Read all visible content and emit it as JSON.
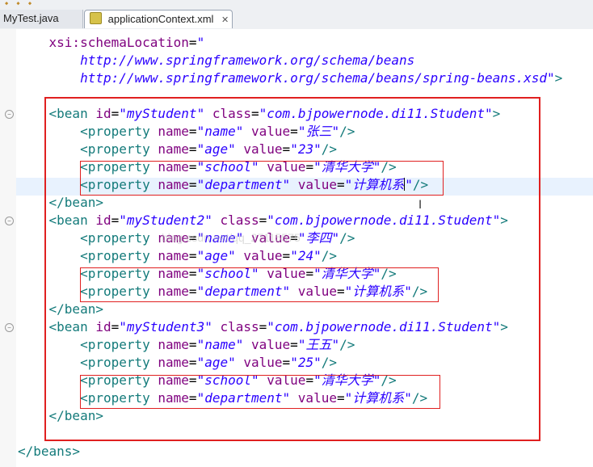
{
  "tabs": [
    {
      "label": "MyTest.java",
      "active": false
    },
    {
      "label": "applicationContext.xml",
      "active": true
    }
  ],
  "editor": {
    "cursor_line": 8,
    "lines": [
      {
        "tokens": [
          [
            "plain",
            "    "
          ],
          [
            "attr",
            "xsi:schemaLocation"
          ],
          [
            "plain",
            "="
          ],
          [
            "val",
            "\""
          ]
        ]
      },
      {
        "tokens": [
          [
            "plain",
            "        "
          ],
          [
            "val",
            "http://www.springframework.org/schema/beans"
          ]
        ]
      },
      {
        "tokens": [
          [
            "plain",
            "        "
          ],
          [
            "val",
            "http://www.springframework.org/schema/beans/spring-beans.xsd\""
          ],
          [
            "tag",
            ">"
          ]
        ]
      },
      {
        "tokens": []
      },
      {
        "tokens": [
          [
            "plain",
            "    "
          ],
          [
            "tag",
            "<bean "
          ],
          [
            "attr",
            "id"
          ],
          [
            "plain",
            "="
          ],
          [
            "val",
            "\"myStudent\""
          ],
          [
            "plain",
            " "
          ],
          [
            "attr",
            "class"
          ],
          [
            "plain",
            "="
          ],
          [
            "val",
            "\"com.bjpowernode.di11.Student\""
          ],
          [
            "tag",
            ">"
          ]
        ]
      },
      {
        "tokens": [
          [
            "plain",
            "        "
          ],
          [
            "tag",
            "<property "
          ],
          [
            "attr",
            "name"
          ],
          [
            "plain",
            "="
          ],
          [
            "val",
            "\"name\""
          ],
          [
            "plain",
            " "
          ],
          [
            "attr",
            "value"
          ],
          [
            "plain",
            "="
          ],
          [
            "val",
            "\"张三\""
          ],
          [
            "tag",
            "/>"
          ]
        ]
      },
      {
        "tokens": [
          [
            "plain",
            "        "
          ],
          [
            "tag",
            "<property "
          ],
          [
            "attr",
            "name"
          ],
          [
            "plain",
            "="
          ],
          [
            "val",
            "\"age\""
          ],
          [
            "plain",
            " "
          ],
          [
            "attr",
            "value"
          ],
          [
            "plain",
            "="
          ],
          [
            "val",
            "\"23\""
          ],
          [
            "tag",
            "/>"
          ]
        ]
      },
      {
        "tokens": [
          [
            "plain",
            "        "
          ],
          [
            "tag",
            "<property "
          ],
          [
            "attr",
            "name"
          ],
          [
            "plain",
            "="
          ],
          [
            "val",
            "\"school\""
          ],
          [
            "plain",
            " "
          ],
          [
            "attr",
            "value"
          ],
          [
            "plain",
            "="
          ],
          [
            "val",
            "\"清华大学\""
          ],
          [
            "tag",
            "/>"
          ]
        ]
      },
      {
        "tokens": [
          [
            "plain",
            "        "
          ],
          [
            "tag",
            "<property "
          ],
          [
            "attr",
            "name"
          ],
          [
            "plain",
            "="
          ],
          [
            "val",
            "\"department\""
          ],
          [
            "plain",
            " "
          ],
          [
            "attr",
            "value"
          ],
          [
            "plain",
            "="
          ],
          [
            "val",
            "\"计算机系"
          ],
          [
            "cursor",
            ""
          ],
          [
            "val",
            "\""
          ],
          [
            "tag",
            "/>"
          ]
        ]
      },
      {
        "tokens": [
          [
            "plain",
            "    "
          ],
          [
            "tag",
            "</bean>"
          ]
        ]
      },
      {
        "tokens": [
          [
            "plain",
            "    "
          ],
          [
            "tag",
            "<bean "
          ],
          [
            "attr",
            "id"
          ],
          [
            "plain",
            "="
          ],
          [
            "val",
            "\"myStudent2\""
          ],
          [
            "plain",
            " "
          ],
          [
            "attr",
            "class"
          ],
          [
            "plain",
            "="
          ],
          [
            "val",
            "\"com.bjpowernode.di11.Student\""
          ],
          [
            "tag",
            ">"
          ]
        ]
      },
      {
        "tokens": [
          [
            "plain",
            "        "
          ],
          [
            "tag",
            "<property "
          ],
          [
            "attr",
            "name"
          ],
          [
            "plain",
            "="
          ],
          [
            "val",
            "\"name\""
          ],
          [
            "plain",
            " "
          ],
          [
            "attr",
            "value"
          ],
          [
            "plain",
            "="
          ],
          [
            "val",
            "\"李四\""
          ],
          [
            "tag",
            "/>"
          ]
        ]
      },
      {
        "tokens": [
          [
            "plain",
            "        "
          ],
          [
            "tag",
            "<property "
          ],
          [
            "attr",
            "name"
          ],
          [
            "plain",
            "="
          ],
          [
            "val",
            "\"age\""
          ],
          [
            "plain",
            " "
          ],
          [
            "attr",
            "value"
          ],
          [
            "plain",
            "="
          ],
          [
            "val",
            "\"24\""
          ],
          [
            "tag",
            "/>"
          ]
        ]
      },
      {
        "tokens": [
          [
            "plain",
            "        "
          ],
          [
            "tag",
            "<property "
          ],
          [
            "attr",
            "name"
          ],
          [
            "plain",
            "="
          ],
          [
            "val",
            "\"school\""
          ],
          [
            "plain",
            " "
          ],
          [
            "attr",
            "value"
          ],
          [
            "plain",
            "="
          ],
          [
            "val",
            "\"清华大学\""
          ],
          [
            "tag",
            "/>"
          ]
        ]
      },
      {
        "tokens": [
          [
            "plain",
            "        "
          ],
          [
            "tag",
            "<property "
          ],
          [
            "attr",
            "name"
          ],
          [
            "plain",
            "="
          ],
          [
            "val",
            "\"department\""
          ],
          [
            "plain",
            " "
          ],
          [
            "attr",
            "value"
          ],
          [
            "plain",
            "="
          ],
          [
            "val",
            "\"计算机系\""
          ],
          [
            "tag",
            "/>"
          ]
        ]
      },
      {
        "tokens": [
          [
            "plain",
            "    "
          ],
          [
            "tag",
            "</bean>"
          ]
        ]
      },
      {
        "tokens": [
          [
            "plain",
            "    "
          ],
          [
            "tag",
            "<bean "
          ],
          [
            "attr",
            "id"
          ],
          [
            "plain",
            "="
          ],
          [
            "val",
            "\"myStudent3\""
          ],
          [
            "plain",
            " "
          ],
          [
            "attr",
            "class"
          ],
          [
            "plain",
            "="
          ],
          [
            "val",
            "\"com.bjpowernode.di11.Student\""
          ],
          [
            "tag",
            ">"
          ]
        ]
      },
      {
        "tokens": [
          [
            "plain",
            "        "
          ],
          [
            "tag",
            "<property "
          ],
          [
            "attr",
            "name"
          ],
          [
            "plain",
            "="
          ],
          [
            "val",
            "\"name\""
          ],
          [
            "plain",
            " "
          ],
          [
            "attr",
            "value"
          ],
          [
            "plain",
            "="
          ],
          [
            "val",
            "\"王五\""
          ],
          [
            "tag",
            "/>"
          ]
        ]
      },
      {
        "tokens": [
          [
            "plain",
            "        "
          ],
          [
            "tag",
            "<property "
          ],
          [
            "attr",
            "name"
          ],
          [
            "plain",
            "="
          ],
          [
            "val",
            "\"age\""
          ],
          [
            "plain",
            " "
          ],
          [
            "attr",
            "value"
          ],
          [
            "plain",
            "="
          ],
          [
            "val",
            "\"25\""
          ],
          [
            "tag",
            "/>"
          ]
        ]
      },
      {
        "tokens": [
          [
            "plain",
            "        "
          ],
          [
            "tag",
            "<property "
          ],
          [
            "attr",
            "name"
          ],
          [
            "plain",
            "="
          ],
          [
            "val",
            "\"school\""
          ],
          [
            "plain",
            " "
          ],
          [
            "attr",
            "value"
          ],
          [
            "plain",
            "="
          ],
          [
            "val",
            "\"清华大学\""
          ],
          [
            "tag",
            "/>"
          ]
        ]
      },
      {
        "tokens": [
          [
            "plain",
            "        "
          ],
          [
            "tag",
            "<property "
          ],
          [
            "attr",
            "name"
          ],
          [
            "plain",
            "="
          ],
          [
            "val",
            "\"department\""
          ],
          [
            "plain",
            " "
          ],
          [
            "attr",
            "value"
          ],
          [
            "plain",
            "="
          ],
          [
            "val",
            "\"计算机系\""
          ],
          [
            "tag",
            "/>"
          ]
        ]
      },
      {
        "tokens": [
          [
            "plain",
            "    "
          ],
          [
            "tag",
            "</bean>"
          ]
        ]
      },
      {
        "tokens": []
      },
      {
        "tokens": [
          [
            "tag",
            "</beans>"
          ]
        ]
      }
    ]
  },
  "watermark": "blog.csdn.net/qq_27115575",
  "colors": {
    "tag": "#137a7a",
    "attribute": "#7f007f",
    "value": "#2a00ff",
    "annotation": "#e02020"
  }
}
